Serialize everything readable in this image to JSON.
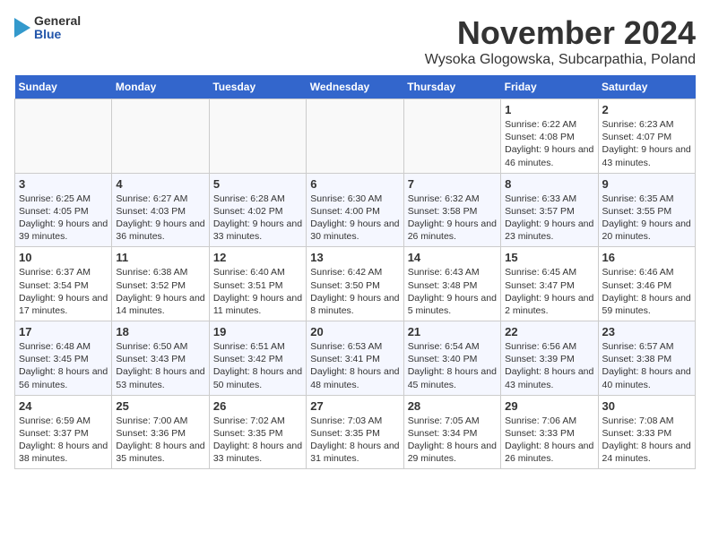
{
  "header": {
    "logo_general": "General",
    "logo_blue": "Blue",
    "month_title": "November 2024",
    "location": "Wysoka Glogowska, Subcarpathia, Poland"
  },
  "weekdays": [
    "Sunday",
    "Monday",
    "Tuesday",
    "Wednesday",
    "Thursday",
    "Friday",
    "Saturday"
  ],
  "weeks": [
    [
      {
        "day": "",
        "detail": ""
      },
      {
        "day": "",
        "detail": ""
      },
      {
        "day": "",
        "detail": ""
      },
      {
        "day": "",
        "detail": ""
      },
      {
        "day": "",
        "detail": ""
      },
      {
        "day": "1",
        "detail": "Sunrise: 6:22 AM\nSunset: 4:08 PM\nDaylight: 9 hours and 46 minutes."
      },
      {
        "day": "2",
        "detail": "Sunrise: 6:23 AM\nSunset: 4:07 PM\nDaylight: 9 hours and 43 minutes."
      }
    ],
    [
      {
        "day": "3",
        "detail": "Sunrise: 6:25 AM\nSunset: 4:05 PM\nDaylight: 9 hours and 39 minutes."
      },
      {
        "day": "4",
        "detail": "Sunrise: 6:27 AM\nSunset: 4:03 PM\nDaylight: 9 hours and 36 minutes."
      },
      {
        "day": "5",
        "detail": "Sunrise: 6:28 AM\nSunset: 4:02 PM\nDaylight: 9 hours and 33 minutes."
      },
      {
        "day": "6",
        "detail": "Sunrise: 6:30 AM\nSunset: 4:00 PM\nDaylight: 9 hours and 30 minutes."
      },
      {
        "day": "7",
        "detail": "Sunrise: 6:32 AM\nSunset: 3:58 PM\nDaylight: 9 hours and 26 minutes."
      },
      {
        "day": "8",
        "detail": "Sunrise: 6:33 AM\nSunset: 3:57 PM\nDaylight: 9 hours and 23 minutes."
      },
      {
        "day": "9",
        "detail": "Sunrise: 6:35 AM\nSunset: 3:55 PM\nDaylight: 9 hours and 20 minutes."
      }
    ],
    [
      {
        "day": "10",
        "detail": "Sunrise: 6:37 AM\nSunset: 3:54 PM\nDaylight: 9 hours and 17 minutes."
      },
      {
        "day": "11",
        "detail": "Sunrise: 6:38 AM\nSunset: 3:52 PM\nDaylight: 9 hours and 14 minutes."
      },
      {
        "day": "12",
        "detail": "Sunrise: 6:40 AM\nSunset: 3:51 PM\nDaylight: 9 hours and 11 minutes."
      },
      {
        "day": "13",
        "detail": "Sunrise: 6:42 AM\nSunset: 3:50 PM\nDaylight: 9 hours and 8 minutes."
      },
      {
        "day": "14",
        "detail": "Sunrise: 6:43 AM\nSunset: 3:48 PM\nDaylight: 9 hours and 5 minutes."
      },
      {
        "day": "15",
        "detail": "Sunrise: 6:45 AM\nSunset: 3:47 PM\nDaylight: 9 hours and 2 minutes."
      },
      {
        "day": "16",
        "detail": "Sunrise: 6:46 AM\nSunset: 3:46 PM\nDaylight: 8 hours and 59 minutes."
      }
    ],
    [
      {
        "day": "17",
        "detail": "Sunrise: 6:48 AM\nSunset: 3:45 PM\nDaylight: 8 hours and 56 minutes."
      },
      {
        "day": "18",
        "detail": "Sunrise: 6:50 AM\nSunset: 3:43 PM\nDaylight: 8 hours and 53 minutes."
      },
      {
        "day": "19",
        "detail": "Sunrise: 6:51 AM\nSunset: 3:42 PM\nDaylight: 8 hours and 50 minutes."
      },
      {
        "day": "20",
        "detail": "Sunrise: 6:53 AM\nSunset: 3:41 PM\nDaylight: 8 hours and 48 minutes."
      },
      {
        "day": "21",
        "detail": "Sunrise: 6:54 AM\nSunset: 3:40 PM\nDaylight: 8 hours and 45 minutes."
      },
      {
        "day": "22",
        "detail": "Sunrise: 6:56 AM\nSunset: 3:39 PM\nDaylight: 8 hours and 43 minutes."
      },
      {
        "day": "23",
        "detail": "Sunrise: 6:57 AM\nSunset: 3:38 PM\nDaylight: 8 hours and 40 minutes."
      }
    ],
    [
      {
        "day": "24",
        "detail": "Sunrise: 6:59 AM\nSunset: 3:37 PM\nDaylight: 8 hours and 38 minutes."
      },
      {
        "day": "25",
        "detail": "Sunrise: 7:00 AM\nSunset: 3:36 PM\nDaylight: 8 hours and 35 minutes."
      },
      {
        "day": "26",
        "detail": "Sunrise: 7:02 AM\nSunset: 3:35 PM\nDaylight: 8 hours and 33 minutes."
      },
      {
        "day": "27",
        "detail": "Sunrise: 7:03 AM\nSunset: 3:35 PM\nDaylight: 8 hours and 31 minutes."
      },
      {
        "day": "28",
        "detail": "Sunrise: 7:05 AM\nSunset: 3:34 PM\nDaylight: 8 hours and 29 minutes."
      },
      {
        "day": "29",
        "detail": "Sunrise: 7:06 AM\nSunset: 3:33 PM\nDaylight: 8 hours and 26 minutes."
      },
      {
        "day": "30",
        "detail": "Sunrise: 7:08 AM\nSunset: 3:33 PM\nDaylight: 8 hours and 24 minutes."
      }
    ]
  ]
}
